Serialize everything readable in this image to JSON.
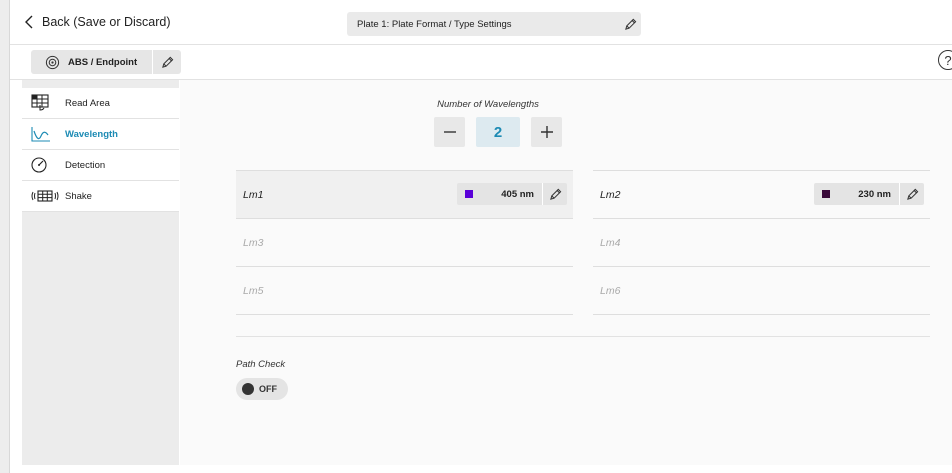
{
  "topbar": {
    "back_label": "Back (Save or Discard)",
    "plate_title": "Plate 1: Plate Format / Type Settings"
  },
  "mode": {
    "label": "ABS / Endpoint",
    "help": "?"
  },
  "sidebar": {
    "items": [
      {
        "label": "Read Area",
        "icon": "read-area-icon"
      },
      {
        "label": "Wavelength",
        "icon": "wavelength-icon",
        "active": true
      },
      {
        "label": "Detection",
        "icon": "detection-icon"
      },
      {
        "label": "Shake",
        "icon": "shake-icon"
      }
    ]
  },
  "wavelengths": {
    "label": "Number of Wavelengths",
    "count": "2",
    "minus": "—",
    "plus": "+",
    "left": [
      {
        "name": "Lm1",
        "value": "405 nm",
        "color": "#5a00d8"
      },
      {
        "name": "Lm3"
      },
      {
        "name": "Lm5"
      }
    ],
    "right": [
      {
        "name": "Lm2",
        "value": "230 nm",
        "color": "#3a0a3a"
      },
      {
        "name": "Lm4"
      },
      {
        "name": "Lm6"
      }
    ]
  },
  "path_check": {
    "label": "Path Check",
    "state": "OFF"
  }
}
